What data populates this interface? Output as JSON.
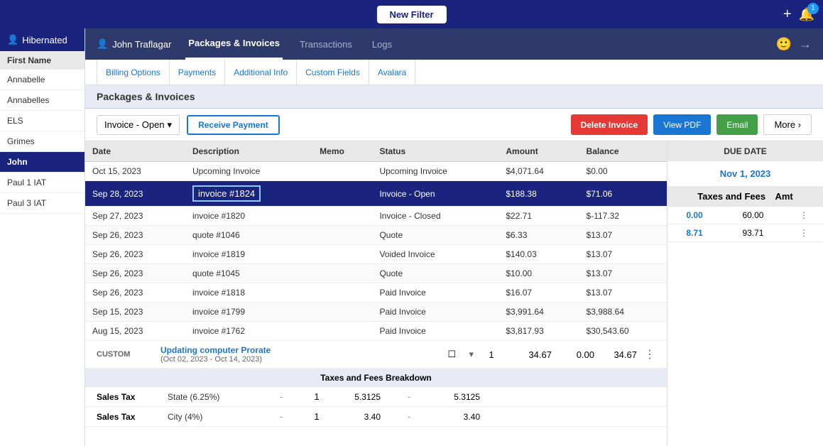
{
  "topbar": {
    "new_filter_label": "New Filter",
    "notification_count": "1"
  },
  "sidebar": {
    "hibernated_label": "Hibernated",
    "section_header": "First Name",
    "items": [
      {
        "label": "Annabelle",
        "active": false
      },
      {
        "label": "Annabelles",
        "active": false
      },
      {
        "label": "ELS",
        "active": false
      },
      {
        "label": "Grimes",
        "active": false
      },
      {
        "label": "John",
        "active": true
      },
      {
        "label": "Paul 1 IAT",
        "active": false
      },
      {
        "label": "Paul 3 IAT",
        "active": false
      }
    ]
  },
  "customer_header": {
    "user_name": "John Traflagar",
    "tabs": [
      {
        "label": "Packages & Invoices",
        "active": true
      },
      {
        "label": "Transactions",
        "active": false
      },
      {
        "label": "Logs",
        "active": false
      }
    ]
  },
  "sub_tabs": [
    {
      "label": "Billing Options"
    },
    {
      "label": "Payments"
    },
    {
      "label": "Additional Info"
    },
    {
      "label": "Custom Fields"
    },
    {
      "label": "Avalara"
    }
  ],
  "page_title": "Packages & Invoices",
  "toolbar": {
    "invoice_dropdown": "Invoice - Open",
    "receive_payment": "Receive Payment",
    "delete_invoice": "Delete Invoice",
    "view_pdf": "View PDF",
    "email": "Email",
    "more": "More ›"
  },
  "table": {
    "columns": [
      "Date",
      "Description",
      "Memo",
      "Status",
      "Amount",
      "Balance"
    ],
    "rows": [
      {
        "date": "Oct 15, 2023",
        "description": "Upcoming Invoice",
        "memo": "",
        "status": "Upcoming Invoice",
        "amount": "$4,071.64",
        "balance": "$0.00",
        "selected": false
      },
      {
        "date": "Sep 28, 2023",
        "description": "invoice #1824",
        "memo": "",
        "status": "Invoice - Open",
        "amount": "$188.38",
        "balance": "$71.06",
        "selected": true
      },
      {
        "date": "Sep 27, 2023",
        "description": "invoice #1820",
        "memo": "",
        "status": "Invoice - Closed",
        "amount": "$22.71",
        "balance": "$-117.32",
        "selected": false
      },
      {
        "date": "Sep 26, 2023",
        "description": "quote #1046",
        "memo": "",
        "status": "Quote",
        "amount": "$6.33",
        "balance": "$13.07",
        "selected": false
      },
      {
        "date": "Sep 26, 2023",
        "description": "invoice #1819",
        "memo": "",
        "status": "Voided Invoice",
        "amount": "$140.03",
        "balance": "$13.07",
        "selected": false
      },
      {
        "date": "Sep 26, 2023",
        "description": "quote #1045",
        "memo": "",
        "status": "Quote",
        "amount": "$10.00",
        "balance": "$13.07",
        "selected": false
      },
      {
        "date": "Sep 26, 2023",
        "description": "invoice #1818",
        "memo": "",
        "status": "Paid Invoice",
        "amount": "$16.07",
        "balance": "$13.07",
        "selected": false
      },
      {
        "date": "Sep 15, 2023",
        "description": "invoice #1799",
        "memo": "",
        "status": "Paid Invoice",
        "amount": "$3,991.64",
        "balance": "$3,988.64",
        "selected": false
      },
      {
        "date": "Aug 15, 2023",
        "description": "invoice #1762",
        "memo": "",
        "status": "Paid Invoice",
        "amount": "$3,817.93",
        "balance": "$30,543.60",
        "selected": false
      }
    ]
  },
  "right_panel": {
    "due_date_header": "DUE DATE",
    "due_date_value": "Nov 1, 2023",
    "taxes_fees_header": "Taxes and Fees",
    "amt_header": "Amt",
    "rows": [
      {
        "value": "0.00",
        "amt": "60.00",
        "blue": true
      },
      {
        "value": "8.71",
        "amt": "93.71",
        "blue": true
      }
    ]
  },
  "custom_row": {
    "label": "CUSTOM",
    "title": "Updating computer Prorate",
    "subtitle": "(Oct 02, 2023 - Oct 14, 2023)",
    "qty": "1",
    "price": "34.67",
    "taxes_fees": "0.00",
    "total": "34.67"
  },
  "taxes_breakdown": {
    "header": "Taxes and Fees Breakdown",
    "rows": [
      {
        "label": "Sales Tax",
        "type": "State (6.25%)",
        "dash": "-",
        "qty": "1",
        "amount": "5.3125",
        "dash2": "-",
        "total": "5.3125"
      },
      {
        "label": "Sales Tax",
        "type": "City (4%)",
        "dash": "-",
        "qty": "1",
        "amount": "3.40",
        "dash2": "-",
        "total": "3.40"
      }
    ]
  }
}
